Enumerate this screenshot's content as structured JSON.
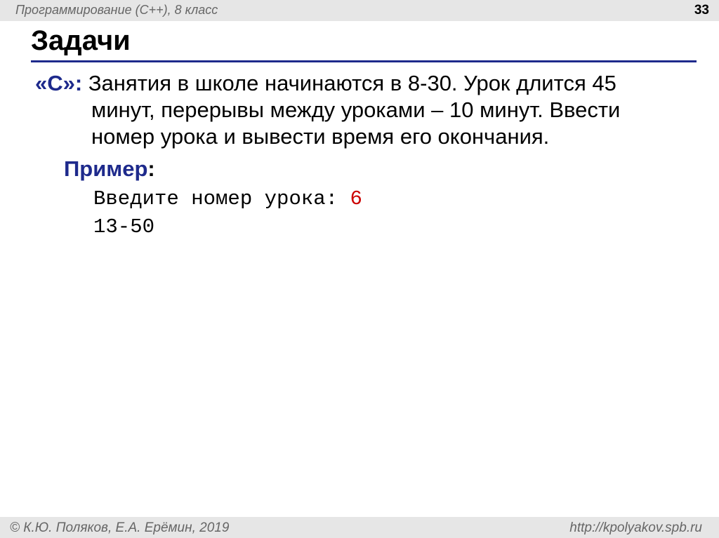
{
  "header": {
    "course": "Программирование (C++), 8 класс",
    "page_number": "33"
  },
  "title": "Задачи",
  "task": {
    "marker": "«C»:",
    "lines": [
      "Занятия в школе начинаются в 8-30. Урок длится 45",
      "минут, перерывы между уроками – 10 минут. Ввести",
      "номер урока и вывести время его окончания."
    ]
  },
  "example": {
    "label": "Пример",
    "colon": ":",
    "prompt": "Введите номер урока: ",
    "input_value": "6",
    "output": "13-50"
  },
  "footer": {
    "copyright": "© К.Ю. Поляков, Е.А. Ерёмин, 2019",
    "url": "http://kpolyakov.spb.ru"
  },
  "colors": {
    "accent": "#1e2a8c",
    "input": "#cc0000",
    "band": "#e6e6e6"
  }
}
